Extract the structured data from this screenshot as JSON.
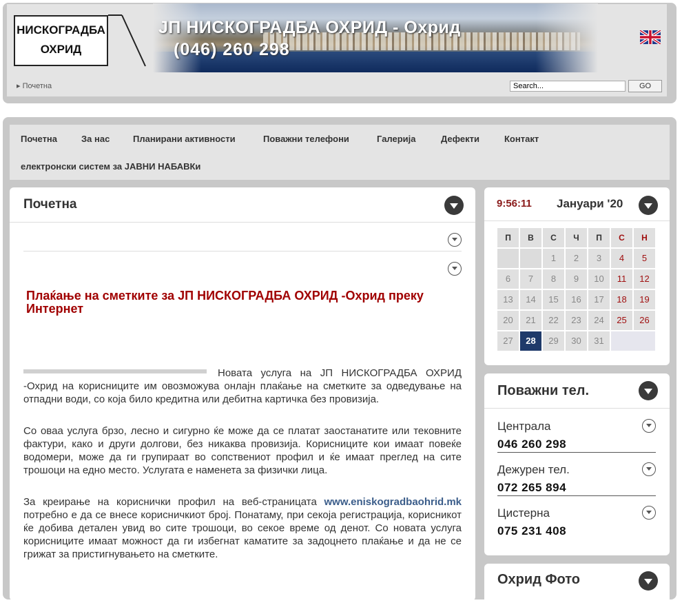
{
  "header": {
    "logo_line1": "НИСКОГРАДБА",
    "logo_line2": "ОХРИД",
    "banner_title": "ЈП НИСКОГРАДБА ОХРИД - Охрид",
    "banner_phone": "(046) 260 298",
    "breadcrumb": "Почетна",
    "search_value": "Search...",
    "search_button": "GO"
  },
  "nav": {
    "items": [
      "Почетна",
      "За нас",
      "Планирани активности",
      "Поважни телефони",
      "Галерија",
      "Дефекти",
      "Контакт"
    ],
    "second_row": "електронски систем за ЈАВНИ НАБАВКи"
  },
  "main": {
    "title": "Почетна",
    "headline": "Плаќање на сметките за ЈП НИСКОГРАДБА ОХРИД -Охрид преку Интернет",
    "para1": "Новата услуга на ЈП НИСКОГРАДБА ОХРИД -Охрид на корисниците им овозможува онлајн плаќање на сметките за одведување на отпадни води, со која било кредитна или дебитна картичка без провизија.",
    "para2": "Со оваа услуга брзо, лесно и сигурно ќе може да се платат заостанатите или тековните фактури, како и други долгови, без никаква провизија. Корисниците кои имаат повеќе водомери, може да ги групираат во сопствениот профил и ќе имаат преглед на сите трошоци на едно место. Услугата е наменета за физички лица.",
    "para3_prefix": "За креирање на кориснички профил на веб-страницата",
    "para3_link": "www.eniskogradbaohrid.mk",
    "para3_suffix": "потребно е да се внесе корисничкиот број. Понатаму, при секоја регистрација, корисникот ќе добива детален увид во сите трошоци, во секое време од денот. Со новата услуга корисниците имаат можност да ги избегнат каматите за задоцнето плаќање и да не се грижат за пристигнувањето на сметките."
  },
  "calendar": {
    "clock": "9:56:11",
    "month": "Јануари '20",
    "weekdays": [
      "П",
      "В",
      "С",
      "Ч",
      "П",
      "С",
      "Н"
    ],
    "days": [
      [
        "",
        "",
        "1",
        "2",
        "3",
        "4",
        "5"
      ],
      [
        "6",
        "7",
        "8",
        "9",
        "10",
        "11",
        "12"
      ],
      [
        "13",
        "14",
        "15",
        "16",
        "17",
        "18",
        "19"
      ],
      [
        "20",
        "21",
        "22",
        "23",
        "24",
        "25",
        "26"
      ],
      [
        "27",
        "28",
        "29",
        "30",
        "31",
        "",
        ""
      ]
    ],
    "today": "28"
  },
  "phones": {
    "title": "Поважни тел.",
    "items": [
      {
        "label": "Централа",
        "number": "046 260 298"
      },
      {
        "label": "Дежурен тел.",
        "number": "072 265 894"
      },
      {
        "label": "Цистерна",
        "number": "075 231 408"
      }
    ]
  },
  "photo": {
    "title": "Охрид Фото"
  }
}
